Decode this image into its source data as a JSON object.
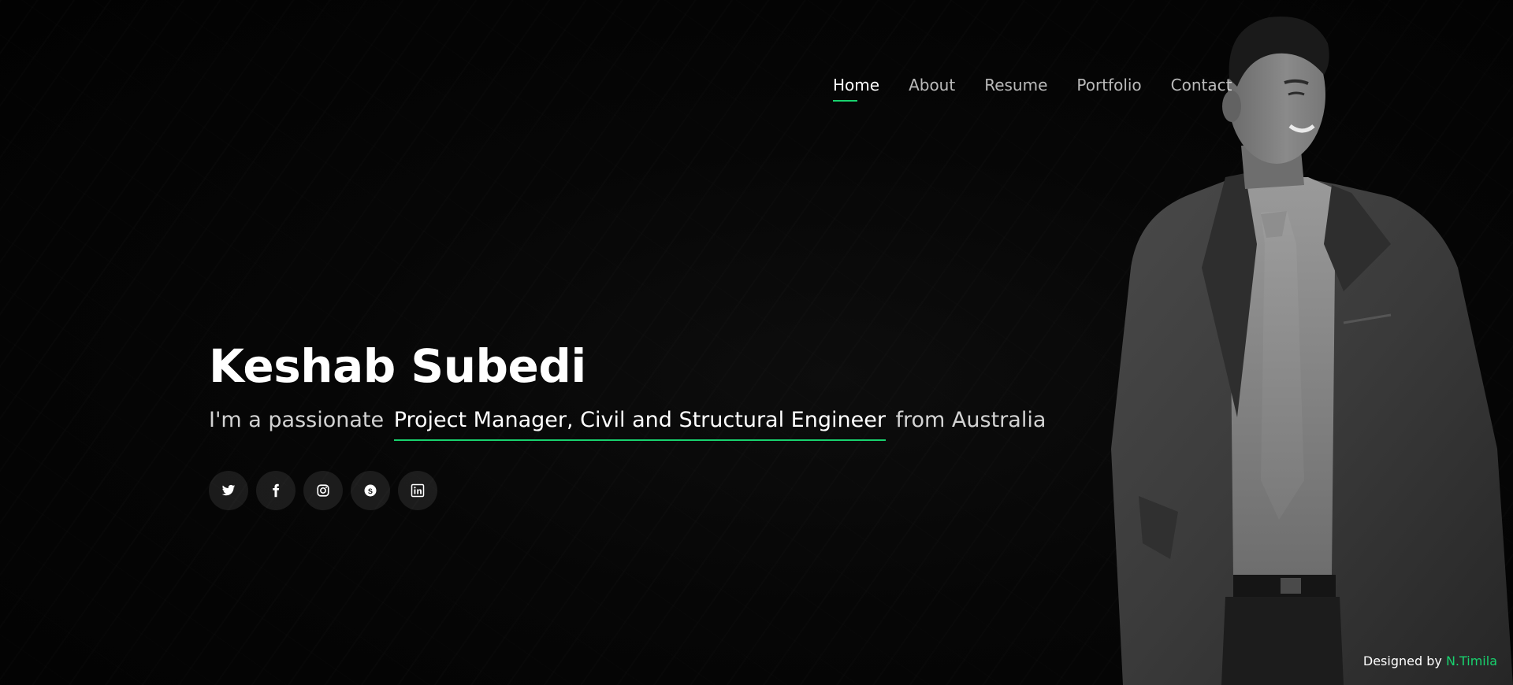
{
  "nav": {
    "items": [
      {
        "label": "Home",
        "active": true
      },
      {
        "label": "About"
      },
      {
        "label": "Resume"
      },
      {
        "label": "Portfolio"
      },
      {
        "label": "Contact"
      }
    ]
  },
  "hero": {
    "name": "Keshab Subedi",
    "subtitle_prefix": "I'm a passionate",
    "subtitle_highlight": "Project Manager, Civil and Structural Engineer",
    "subtitle_suffix": "from Australia"
  },
  "socials": [
    {
      "icon": "twitter-icon"
    },
    {
      "icon": "facebook-icon"
    },
    {
      "icon": "instagram-icon"
    },
    {
      "icon": "skype-icon"
    },
    {
      "icon": "linkedin-icon"
    }
  ],
  "credits": {
    "prefix": "Designed by",
    "author": "N.Timila"
  },
  "colors": {
    "accent": "#18d26e",
    "background": "#040404",
    "text": "#ffffff"
  }
}
